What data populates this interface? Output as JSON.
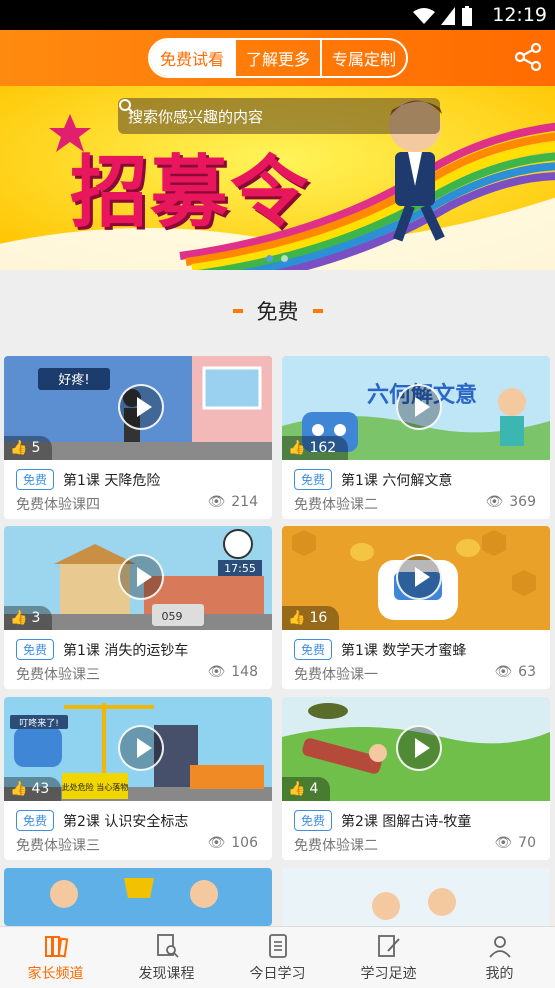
{
  "status": {
    "time": "12:19"
  },
  "header": {
    "tabs": [
      {
        "label": "免费试看",
        "active": true
      },
      {
        "label": "了解更多",
        "active": false
      },
      {
        "label": "专属定制",
        "active": false
      }
    ]
  },
  "banner": {
    "search_placeholder": "搜索你感兴趣的内容",
    "title_text": "招募令"
  },
  "section": {
    "title": "免费"
  },
  "cards": [
    {
      "likes": "5",
      "badge": "免费",
      "title": "第1课  天降危险",
      "subtitle": "免费体验课四",
      "views": "214"
    },
    {
      "likes": "162",
      "badge": "免费",
      "title": "第1课  六何解文意",
      "subtitle": "免费体验课二",
      "views": "369"
    },
    {
      "likes": "3",
      "badge": "免费",
      "title": "第1课  消失的运钞车",
      "subtitle": "免费体验课三",
      "views": "148"
    },
    {
      "likes": "16",
      "badge": "免费",
      "title": "第1课  数学天才蜜蜂",
      "subtitle": "免费体验课一",
      "views": "63"
    },
    {
      "likes": "43",
      "badge": "免费",
      "title": "第2课  认识安全标志",
      "subtitle": "免费体验课三",
      "views": "106"
    },
    {
      "likes": "4",
      "badge": "免费",
      "title": "第2课  图解古诗-牧童",
      "subtitle": "免费体验课二",
      "views": "70"
    }
  ],
  "thumb_texts": {
    "t1": "好疼!",
    "t2": "六何解文意",
    "t3": "17:55",
    "t3b": "059",
    "t5": "叮咚来了!",
    "t5b": "此处危险 当心落物"
  },
  "tabbar": [
    {
      "label": "家长频道",
      "icon": "books-icon",
      "active": true
    },
    {
      "label": "发现课程",
      "icon": "search-doc-icon",
      "active": false
    },
    {
      "label": "今日学习",
      "icon": "document-icon",
      "active": false
    },
    {
      "label": "学习足迹",
      "icon": "edit-doc-icon",
      "active": false
    },
    {
      "label": "我的",
      "icon": "person-icon",
      "active": false
    }
  ],
  "colors": {
    "accent": "#ff6b00",
    "badge": "#3e8ee0"
  }
}
